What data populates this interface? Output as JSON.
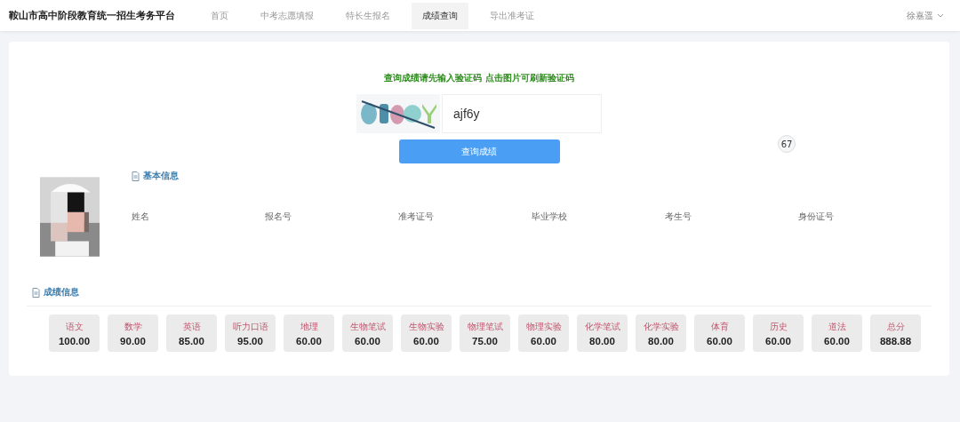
{
  "header": {
    "title": "鞍山市高中阶段教育统一招生考务平台",
    "nav": [
      {
        "label": "首页",
        "selected": false
      },
      {
        "label": "中考志愿填报",
        "selected": false
      },
      {
        "label": "特长生报名",
        "selected": false
      },
      {
        "label": "成绩查询",
        "selected": true
      },
      {
        "label": "导出准考证",
        "selected": false
      }
    ],
    "user": "徐嘉遥"
  },
  "query": {
    "prompt": "查询成绩请先输入验证码 点击图片可刷新验证码",
    "code_value": "ajf6y",
    "button": "查询成绩",
    "badge": "67"
  },
  "basic_info": {
    "heading": "基本信息",
    "fields": [
      "姓名",
      "报名号",
      "准考证号",
      "毕业学校",
      "考生号",
      "身份证号"
    ]
  },
  "scores": {
    "heading": "成绩信息",
    "items": [
      {
        "subject": "语文",
        "score": "100.00"
      },
      {
        "subject": "数学",
        "score": "90.00"
      },
      {
        "subject": "英语",
        "score": "85.00"
      },
      {
        "subject": "听力口语",
        "score": "95.00"
      },
      {
        "subject": "地理",
        "score": "60.00"
      },
      {
        "subject": "生物笔试",
        "score": "60.00"
      },
      {
        "subject": "生物实验",
        "score": "60.00"
      },
      {
        "subject": "物理笔试",
        "score": "75.00"
      },
      {
        "subject": "物理实验",
        "score": "60.00"
      },
      {
        "subject": "化学笔试",
        "score": "80.00"
      },
      {
        "subject": "化学实验",
        "score": "80.00"
      },
      {
        "subject": "体育",
        "score": "60.00"
      },
      {
        "subject": "历史",
        "score": "60.00"
      },
      {
        "subject": "道法",
        "score": "60.00"
      },
      {
        "subject": "总分",
        "score": "888.88"
      }
    ]
  }
}
